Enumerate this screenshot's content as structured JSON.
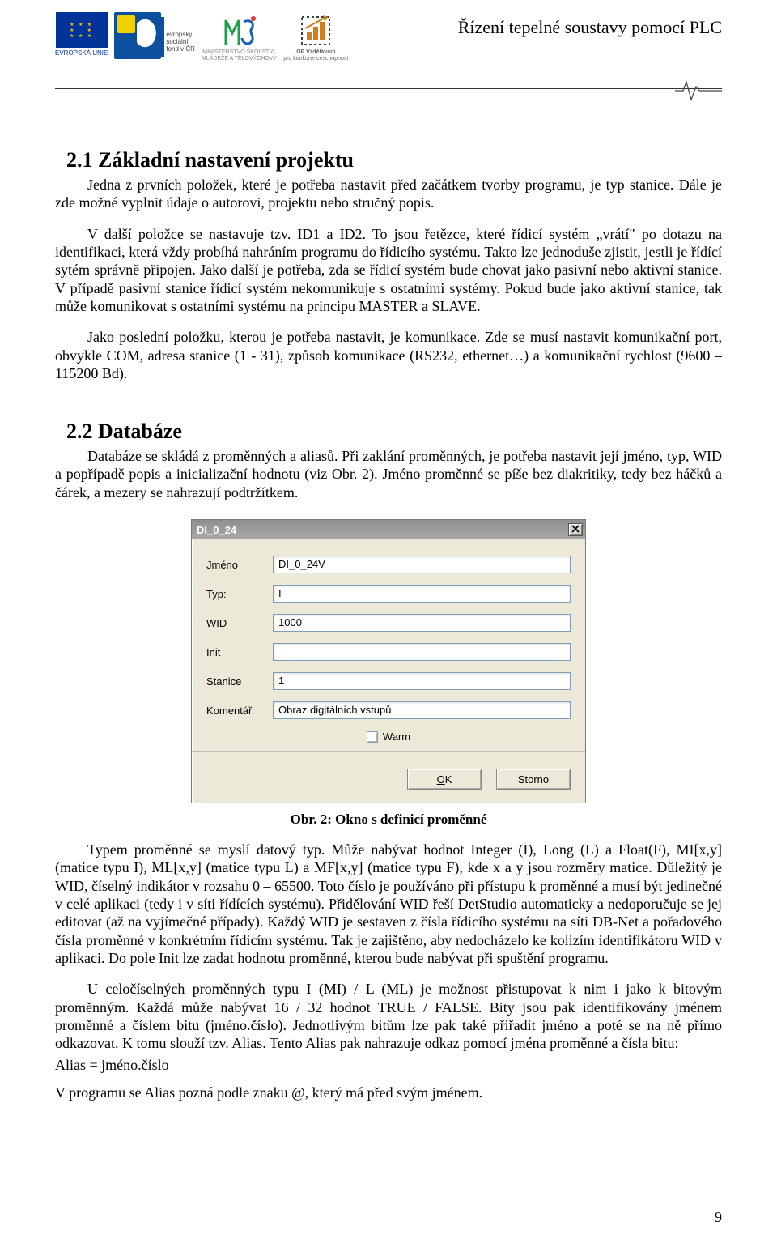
{
  "header": {
    "doc_title": "Řízení tepelné soustavy pomocí PLC",
    "eu_label": "EVROPSKÁ UNIE",
    "msmt_line1": "MINISTERSTVO ŠKOLSTVÍ,",
    "msmt_line2": "MLÁDEŽE A TĚLOVÝCHOVY",
    "op_line1": "OP Vzdělávání",
    "op_line2": "pro konkurenceschopnost",
    "esf_line1": "evropský",
    "esf_line2": "sociální",
    "esf_line3": "fond v ČR"
  },
  "sections": {
    "s1_title": "2.1 Základní nastavení projektu",
    "s1_p1": "Jedna z prvních položek, které je potřeba nastavit před začátkem tvorby programu, je typ stanice. Dále je zde možné vyplnit údaje o autorovi, projektu nebo stručný popis.",
    "s1_p2": "V další položce se nastavuje tzv. ID1 a ID2. To jsou řetězce, které řídicí systém „vrátí\" po dotazu na identifikaci, která vždy probíhá nahráním programu do řídicího systému. Takto lze jednoduše zjistit, jestli je řídící sytém správně připojen. Jako další je potřeba, zda se řídicí systém bude chovat jako pasivní nebo aktivní stanice. V případě pasivní stanice řídicí systém nekomunikuje s ostatními systémy. Pokud bude jako aktivní stanice, tak může komunikovat s ostatními systému na principu MASTER a SLAVE.",
    "s1_p3": "Jako poslední položku, kterou je potřeba nastavit, je komunikace. Zde se musí nastavit komunikační port, obvykle COM, adresa stanice (1 - 31), způsob komunikace (RS232, ethernet…) a komunikační rychlost (9600 – 115200 Bd).",
    "s2_title": "2.2 Databáze",
    "s2_p1": "Databáze se skládá z proměnných a aliasů. Při zaklání proměnných, je potřeba nastavit její jméno, typ, WID a popřípadě popis a inicializační hodnotu (viz Obr. 2). Jméno proměnné se píše bez diakritiky, tedy bez háčků a čárek, a mezery se nahrazují podtržítkem.",
    "caption": "Obr. 2: Okno s definicí proměnné",
    "s2_p2": "Typem proměnné se myslí datový typ. Může nabývat hodnot Integer (I), Long (L) a Float(F), MI[x,y] (matice typu I), ML[x,y] (matice typu L) a MF[x,y] (matice typu F), kde x a y jsou rozměry matice. Důležitý je WID, číselný indikátor v rozsahu 0 – 65500. Toto číslo je používáno při přístupu k proměnné a musí být jedinečné v celé aplikaci (tedy i v síti řídících systému). Přidělování WID řeší DetStudio automaticky a nedoporučuje se jej editovat (až na vyjímečné případy). Každý WID je sestaven z čísla řídicího systému na síti DB-Net a pořadového čísla proměnné v konkrétním řídicím systému. Tak je zajištěno, aby nedocházelo ke kolizím identifikátoru WID v aplikaci. Do pole Init lze zadat hodnotu proměnné, kterou bude nabývat při spuštění programu.",
    "s2_p3": "U celočíselných proměnných typu I (MI) / L (ML) je možnost přistupovat k nim i jako k bitovým proměnným. Každá může nabývat 16 / 32 hodnot TRUE / FALSE. Bity jsou pak identifikovány jménem proměnné a číslem bitu (jméno.číslo). Jednotlivým bitům lze pak také přiřadit jméno a poté se na ně přímo odkazovat. K tomu slouží tzv. Alias. Tento Alias pak nahrazuje odkaz pomocí jména proměnné a čísla bitu:",
    "s2_eq": "Alias = jméno.číslo",
    "s2_p4": "V programu se Alias pozná podle znaku @, který má před svým jménem."
  },
  "dialog": {
    "title": "DI_0_24",
    "fields": {
      "jmeno_label": "Jméno",
      "jmeno_value": "DI_0_24V",
      "typ_label": "Typ:",
      "typ_value": "I",
      "wid_label": "WID",
      "wid_value": "1000",
      "init_label": "Init",
      "init_value": "",
      "stanice_label": "Stanice",
      "stanice_value": "1",
      "komentar_label": "Komentář",
      "komentar_value": "Obraz digitálních vstupů",
      "warm_label": "Warm"
    },
    "buttons": {
      "ok_u": "O",
      "ok_rest": "K",
      "storno": "Storno"
    }
  },
  "page_number": "9"
}
